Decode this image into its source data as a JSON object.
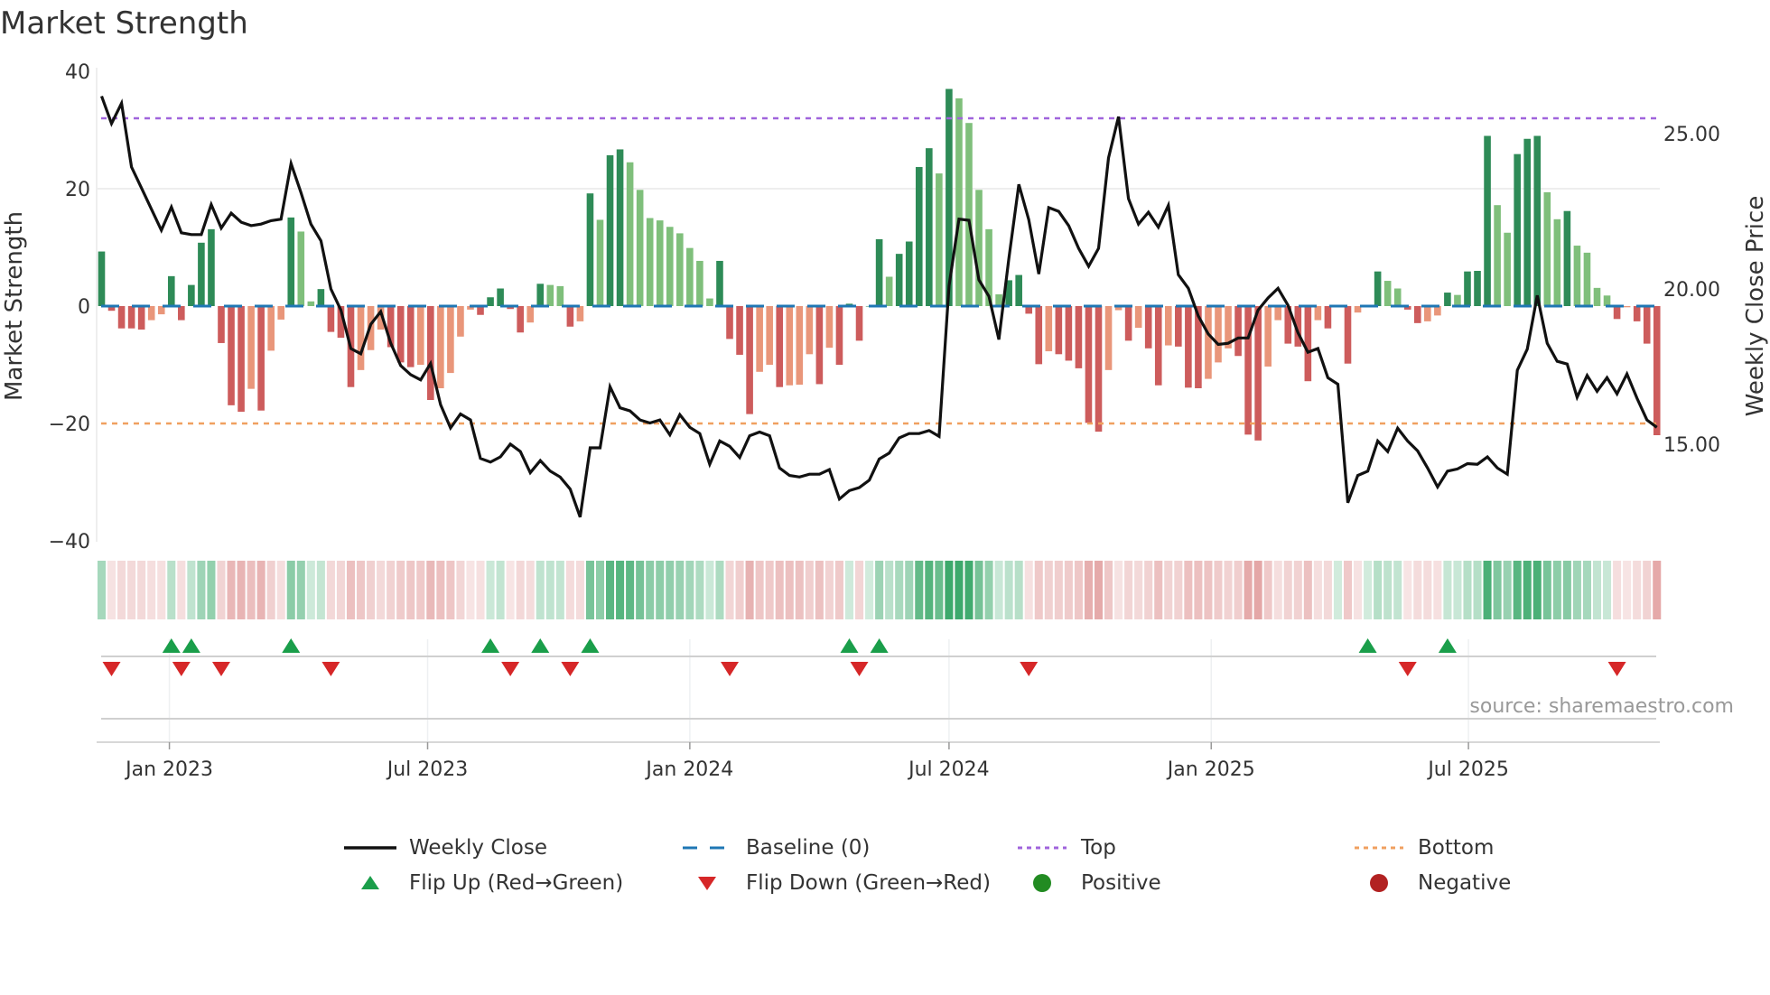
{
  "title": "Market Strength",
  "source": "source: sharemaestro.com",
  "colors": {
    "pos_rising": "#2e8b57",
    "pos_falling": "#7fbf7b",
    "neg_falling": "#cd5c5c",
    "neg_rising": "#e9967a",
    "line": "#111111",
    "baseline": "#1f77b4",
    "top": "#a064dc",
    "bottom": "#f0a060",
    "flip_up": "#1a9e4a",
    "flip_down": "#d62728",
    "positive": "#228b22",
    "negative": "#b22222"
  },
  "chart_data": {
    "type": "bar",
    "title": "Market Strength",
    "ylabel": "Market Strength",
    "y2label": "Weekly Close Price",
    "ylim": [
      -40,
      40
    ],
    "y2lim": [
      11.2,
      27.6
    ],
    "yticks": [
      "40",
      "20",
      "0",
      "−20",
      "−40"
    ],
    "ytick_values": [
      40,
      20,
      0,
      -20,
      -40
    ],
    "y2ticks": [
      "25.00",
      "20.00",
      "15.00"
    ],
    "y2tick_values": [
      25,
      20,
      15
    ],
    "top_level": 32,
    "bottom_level": -20,
    "xticks": [
      {
        "label": "Jan 2023",
        "week": 6.8
      },
      {
        "label": "Jul 2023",
        "week": 32.7
      },
      {
        "label": "Jan 2024",
        "week": 59.0
      },
      {
        "label": "Jul 2024",
        "week": 85.0
      },
      {
        "label": "Jan 2025",
        "week": 111.3
      },
      {
        "label": "Jul 2025",
        "week": 137.1
      }
    ],
    "strength": [
      9.3,
      -0.8,
      -3.8,
      -3.8,
      -4,
      -2.4,
      -1.4,
      5.1,
      -2.4,
      3.6,
      10.8,
      13.1,
      -6.3,
      -16.9,
      -18,
      -14.1,
      -17.8,
      -7.6,
      -2.3,
      15.1,
      12.7,
      0.8,
      2.9,
      -4.4,
      -5.4,
      -13.8,
      -10.9,
      -7.5,
      -4,
      -7,
      -9.6,
      -10.4,
      -10,
      -16,
      -14,
      -11.4,
      -5.2,
      -0.6,
      -1.5,
      1.5,
      3,
      -0.5,
      -4.5,
      -2.8,
      3.8,
      3.6,
      3.4,
      -3.5,
      -2.6,
      19.2,
      14.7,
      25.7,
      26.7,
      24.5,
      19.8,
      15,
      14.6,
      13.5,
      12.4,
      9.9,
      7.7,
      1.3,
      7.7,
      -5.6,
      -8.3,
      -18.4,
      -11.2,
      -10,
      -13.8,
      -13.5,
      -13.4,
      -8.2,
      -13.3,
      -7.1,
      -10,
      0.4,
      -5.9,
      0,
      11.4,
      5,
      8.9,
      11,
      23.7,
      26.9,
      22.6,
      37,
      35.4,
      31.2,
      19.8,
      13.1,
      2,
      4.4,
      5.3,
      -1.3,
      -9.9,
      -7.7,
      -8.2,
      -9.3,
      -10.6,
      -19.9,
      -21.4,
      -10.9,
      -0.7,
      -5.9,
      -3.7,
      -7.2,
      -13.5,
      -6.7,
      -6.9,
      -13.9,
      -14,
      -12.4,
      -9.6,
      -7.2,
      -8.5,
      -21.9,
      -22.9,
      -10.3,
      -2.4,
      -6.4,
      -6.9,
      -12.8,
      -2.4,
      -3.8,
      0,
      -9.8,
      -1.1,
      0.2,
      5.9,
      4.3,
      3,
      -0.6,
      -2.9,
      -2.6,
      -1.6,
      2.3,
      1.9,
      5.9,
      6,
      29,
      17.2,
      12.5,
      25.9,
      28.5,
      29,
      19.4,
      14.8,
      16.2,
      10.3,
      9.1,
      3.1,
      1.8,
      -2.2,
      -0.2,
      -2.6,
      -6.4,
      -22
    ],
    "weekly_close": [
      26.21,
      25.33,
      25.98,
      23.93,
      23.25,
      22.57,
      21.89,
      22.64,
      21.81,
      21.75,
      21.75,
      22.72,
      21.96,
      22.44,
      22.15,
      22.04,
      22.09,
      22.2,
      22.25,
      24.04,
      23.1,
      22.09,
      21.55,
      20.0,
      19.32,
      18.08,
      17.91,
      18.86,
      19.27,
      18.25,
      17.53,
      17.24,
      17.07,
      17.6,
      16.27,
      15.52,
      15.97,
      15.78,
      14.54,
      14.42,
      14.59,
      15.0,
      14.76,
      14.08,
      14.47,
      14.13,
      13.94,
      13.55,
      12.65,
      14.88,
      14.88,
      16.85,
      16.17,
      16.07,
      15.78,
      15.68,
      15.78,
      15.3,
      15.95,
      15.54,
      15.34,
      14.35,
      15.1,
      14.93,
      14.57,
      15.27,
      15.39,
      15.27,
      14.23,
      13.99,
      13.94,
      14.03,
      14.03,
      14.18,
      13.23,
      13.5,
      13.6,
      13.84,
      14.52,
      14.71,
      15.2,
      15.34,
      15.34,
      15.44,
      15.25,
      20.1,
      22.25,
      22.21,
      20.29,
      19.76,
      18.37,
      20.97,
      23.37,
      22.23,
      20.48,
      22.62,
      22.5,
      22.04,
      21.31,
      20.73,
      21.31,
      24.22,
      25.55,
      22.91,
      22.09,
      22.47,
      21.99,
      22.69,
      20.46,
      20.02,
      19.13,
      18.55,
      18.21,
      18.25,
      18.42,
      18.42,
      19.32,
      19.71,
      20.02,
      19.47,
      18.59,
      17.96,
      18.08,
      17.14,
      16.93,
      13.11,
      13.99,
      14.13,
      15.1,
      14.76,
      15.51,
      15.1,
      14.78,
      14.23,
      13.62,
      14.13,
      14.2,
      14.37,
      14.35,
      14.59,
      14.23,
      14.03,
      17.38,
      18.06,
      19.79,
      18.25,
      17.67,
      17.58,
      16.51,
      17.21,
      16.7,
      17.14,
      16.62,
      17.26,
      16.48,
      15.78,
      15.54
    ],
    "flip_up_weeks": [
      7,
      9,
      19,
      39,
      44,
      49,
      75,
      78,
      127,
      135
    ],
    "flip_down_weeks": [
      1,
      8,
      12,
      23,
      41,
      47,
      63,
      76,
      93,
      131,
      152
    ],
    "legend_placement": "bottom-center",
    "legend": [
      {
        "label": "Weekly Close",
        "kind": "line"
      },
      {
        "label": "Baseline (0)",
        "kind": "dashed"
      },
      {
        "label": "Top",
        "kind": "dotted-top"
      },
      {
        "label": "Bottom",
        "kind": "dotted-bottom"
      },
      {
        "label": "Flip Up (Red→Green)",
        "kind": "tri-up"
      },
      {
        "label": "Flip Down (Green→Red)",
        "kind": "tri-down"
      },
      {
        "label": "Positive",
        "kind": "dot-pos"
      },
      {
        "label": "Negative",
        "kind": "dot-neg"
      }
    ]
  }
}
